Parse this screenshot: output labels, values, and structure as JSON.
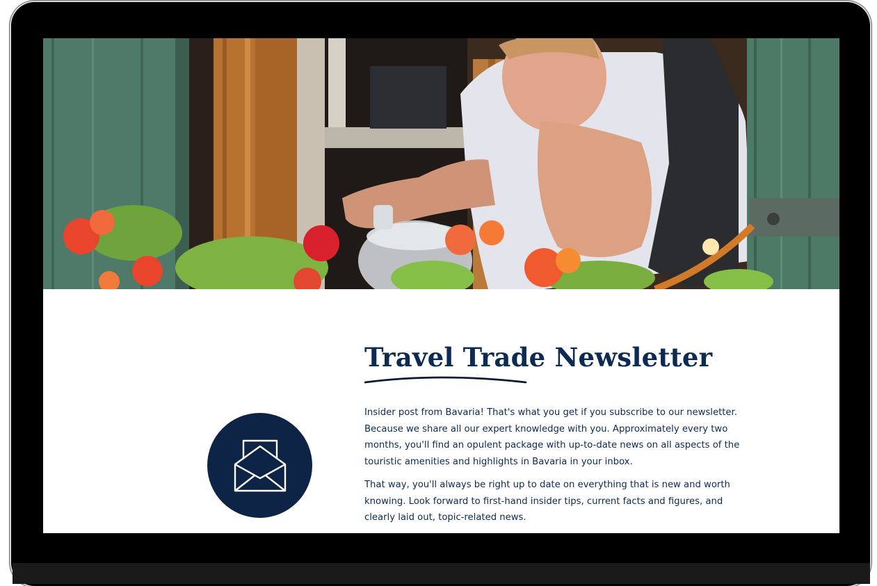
{
  "hero": {
    "image_subject": "woman-watering-flowers-in-window"
  },
  "newsletter": {
    "title": "Travel Trade Newsletter",
    "paragraphs": [
      "Insider post from Bavaria! That's what you get if you subscribe to our newsletter. Because we share all our expert knowledge with you. Approximately every two months, you'll find an opulent package with up-to-date news on all aspects of the touristic amenities and highlights in Bavaria in your inbox.",
      "That way, you'll always be right up to date on everything that is new and worth knowing. Look forward to first-hand insider tips, current facts and figures, and clearly laid out, topic-related news."
    ],
    "icon": "envelope-open-icon"
  },
  "colors": {
    "navy": "#0d2a52",
    "circle": "#0d2447",
    "frame": "#000000"
  }
}
